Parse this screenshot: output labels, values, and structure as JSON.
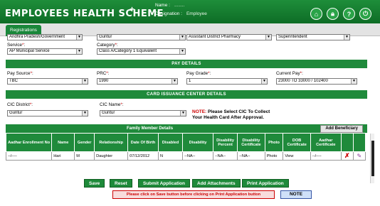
{
  "header": {
    "top_text": "",
    "title": "EMPLOYEES HEALTH SCHEME",
    "plus": "+",
    "name_label": "Name :",
    "name_value": "........",
    "designation_label": "Designation :",
    "designation_value": "Employee",
    "icons": [
      "home-icon",
      "lock-icon",
      "help-icon",
      "power-icon"
    ]
  },
  "tabs": [
    {
      "label": "Registrations"
    }
  ],
  "form": {
    "row0": {
      "sel1": "Andhra Pradesh/Government",
      "sel2": "Guntur",
      "sel3": "Assistant District Pharmacy",
      "sel4": "Superintendent"
    },
    "service_label": "Service",
    "service_value": "AP Municipal Service",
    "category_label": "Category",
    "category_value": "Class A/Category 1 Equivalent",
    "pay_band": "PAY DETAILS",
    "pay_source_label": "Pay Source",
    "pay_source_value": "TBC",
    "prc_label": "PRC",
    "prc_value": "1990",
    "pay_grade_label": "Pay Grade",
    "pay_grade_value": "1",
    "current_pay_label": "Current Pay",
    "current_pay_value": "23000 TO 33000 / 102400",
    "cic_band": "CARD ISSUANCE CENTER DETAILS",
    "cic_district_label": "CIC District",
    "cic_district_value": "Guntur",
    "cic_name_label": "CIC Name",
    "cic_name_value": "Guntur",
    "note_label": "NOTE:",
    "note_line1": "Please Select CIC To Collect",
    "note_line2": "Your Health Card After Approval."
  },
  "family": {
    "title": "Family Member Details",
    "add_button": "Add Beneficiary",
    "columns": [
      "Aadhar Enrollment No",
      "Name",
      "Gender",
      "Relationship",
      "Date Of Birth",
      "Disabled",
      "Disability",
      "Disability Percent",
      "Disability Certificate",
      "Photo",
      "DOB Certificate",
      "Aadhar Certificate",
      "",
      ""
    ],
    "rows": [
      [
        "--/----",
        "Hari",
        "M",
        "Daughter",
        "07/12/2012",
        "N",
        "--NA--",
        "--NA--",
        "--NA--",
        "Photo",
        "View",
        "--/----"
      ]
    ]
  },
  "buttons": {
    "save": "Save",
    "reset": "Reset",
    "submit": "Submit Application",
    "attachments": "Add Attachments",
    "print": "Print Application"
  },
  "warning": "Please click on Save button before clicking on Print Application button",
  "note_button": "NOTE"
}
